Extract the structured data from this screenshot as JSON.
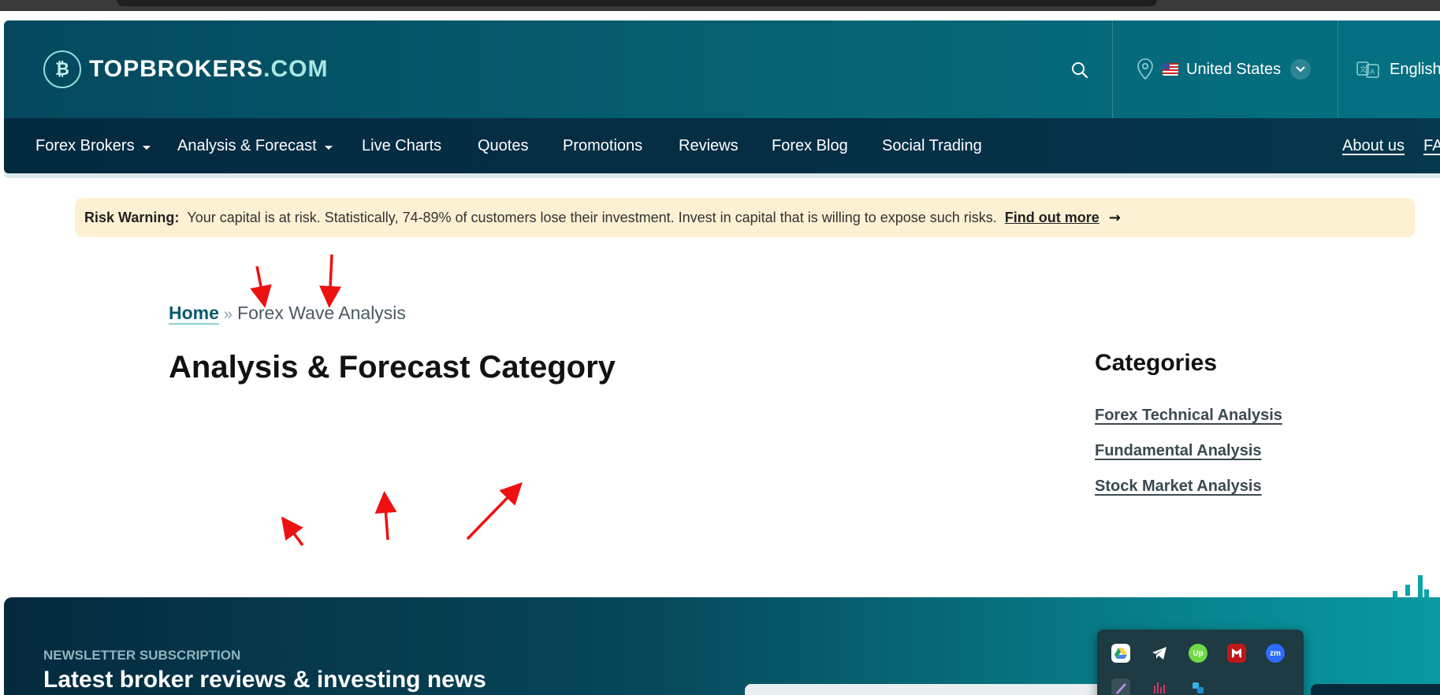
{
  "header": {
    "logo_prefix": "TOPBROKERS",
    "logo_suffix": ".COM",
    "location": "United States",
    "language": "English"
  },
  "nav": {
    "items": [
      {
        "label": "Forex Brokers",
        "dropdown": true
      },
      {
        "label": "Analysis & Forecast",
        "dropdown": true
      },
      {
        "label": "Live Charts",
        "dropdown": false
      },
      {
        "label": "Quotes",
        "dropdown": false
      },
      {
        "label": "Promotions",
        "dropdown": false
      },
      {
        "label": "Reviews",
        "dropdown": false
      },
      {
        "label": "Forex Blog",
        "dropdown": false
      },
      {
        "label": "Social Trading",
        "dropdown": false
      }
    ],
    "right": {
      "about": "About us",
      "faq": "FA"
    }
  },
  "risk": {
    "label": "Risk Warning:",
    "message": "Your capital is at risk. Statistically, 74-89% of customers lose their investment. Invest in capital that is willing to expose such risks.",
    "link": "Find out more"
  },
  "breadcrumb": {
    "home": "Home",
    "separator": "»",
    "current": "Forex Wave Analysis"
  },
  "page_title": "Analysis & Forecast Category",
  "sidebar": {
    "title": "Categories",
    "links": [
      "Forex Technical Analysis",
      "Fundamental Analysis",
      "Stock Market Analysis"
    ]
  },
  "newsletter": {
    "kicker": "NEWSLETTER SUBSCRIPTION",
    "heading": "Latest broker reviews & investing news"
  },
  "tray": {
    "icons": [
      "google-drive-icon",
      "telegram-icon",
      "upwork-icon",
      "mcafee-icon",
      "zoom-icon",
      "pen-icon",
      "audio-icon",
      "app-icon"
    ],
    "zoom_text": "zm",
    "upwork_text": "Up"
  },
  "colors": {
    "header_bg": "#04485e",
    "nav_bg": "#042a40",
    "risk_bg": "#fdf1d4",
    "link_teal": "#07596c",
    "annotation_red": "#ee1111"
  }
}
